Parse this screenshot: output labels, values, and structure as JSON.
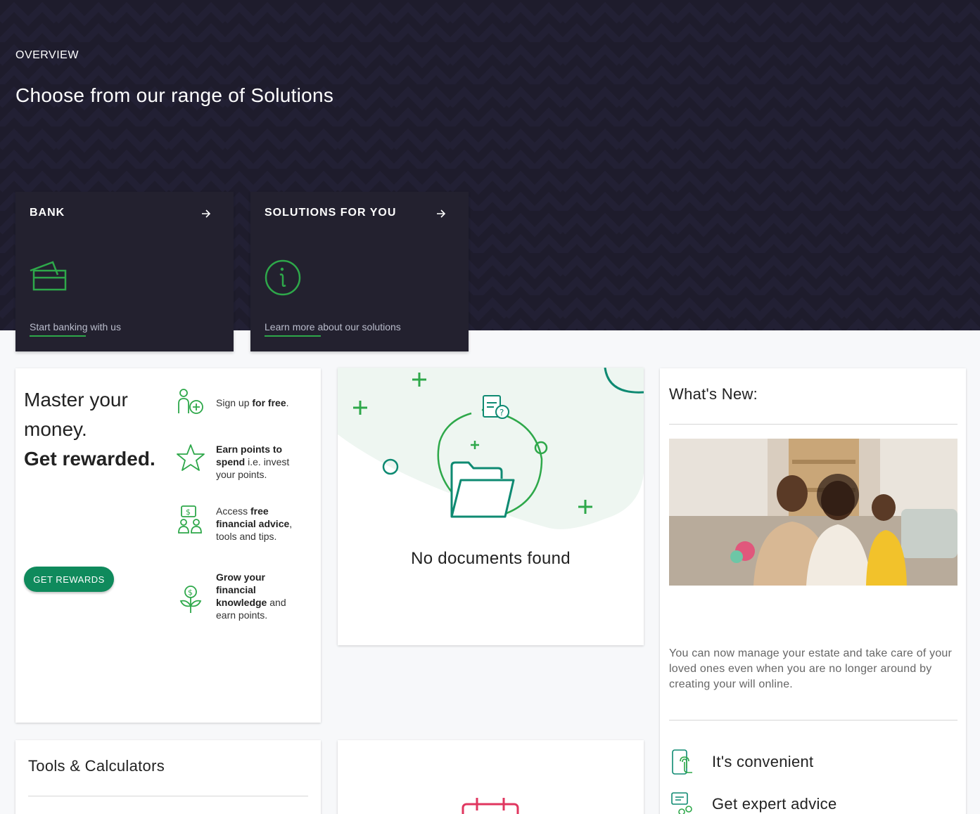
{
  "hero": {
    "eyebrow": "OVERVIEW",
    "title": "Choose from our range of Solutions"
  },
  "tiles": [
    {
      "title": "BANK",
      "icon": "bank-cards-icon",
      "link": "Start banking with us"
    },
    {
      "title": "SOLUTIONS FOR YOU",
      "icon": "info-circle-icon",
      "link": "Learn more about our solutions"
    }
  ],
  "rewards": {
    "heading_line1": "Master your money.",
    "heading_line2": "Get rewarded.",
    "button": "GET REWARDS",
    "perks": [
      {
        "icon": "person-add-icon",
        "bold": "",
        "pre": "Sign up ",
        "bold2": "for free",
        "post": "."
      },
      {
        "icon": "star-icon",
        "pre": "",
        "bold2": "Earn points to spend",
        "post": " i.e. invest your points."
      },
      {
        "icon": "financial-advice-icon",
        "pre": "Access ",
        "bold2": "free financial advice",
        "post": ", tools and tips."
      },
      {
        "icon": "money-plant-icon",
        "pre": "",
        "bold2": "Grow your financial knowledge",
        "post": " and earn points."
      }
    ]
  },
  "documents": {
    "message": "No documents found"
  },
  "whats_new": {
    "title": "What's New:",
    "description": "You can now manage your estate and take care of your loved ones even when you are no longer around by creating your will online.",
    "items": [
      {
        "icon": "touch-phone-icon",
        "label": "It's convenient"
      },
      {
        "icon": "expert-advice-icon",
        "label": "Get expert advice"
      }
    ]
  },
  "tools": {
    "title": "Tools & Calculators"
  },
  "colors": {
    "hero_bg": "#1e1c2c",
    "tile_bg": "#23212f",
    "accent_green": "#2ea84a",
    "button_green": "#0f8a5c",
    "teal": "#0e8a72"
  }
}
